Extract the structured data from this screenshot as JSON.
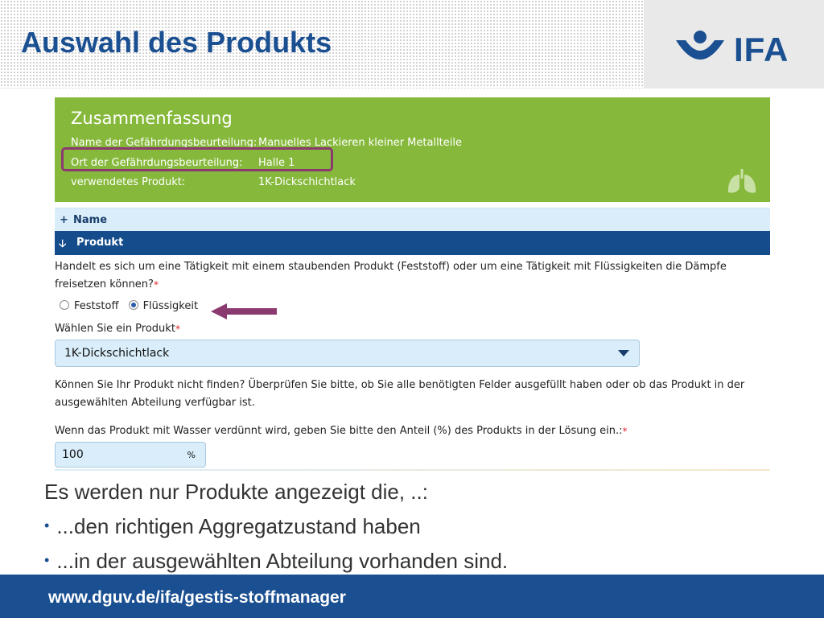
{
  "slide": {
    "title": "Auswahl des Produkts"
  },
  "logo": {
    "text": "IFA"
  },
  "summary": {
    "title": "Zusammenfassung",
    "rows": [
      {
        "label": "Name der Gefährdungsbeurteilung:",
        "value": "Manuelles Lackieren kleiner Metallteile"
      },
      {
        "label": "Ort der Gefährdungsbeurteilung:",
        "value": "Halle 1"
      },
      {
        "label": "verwendetes Produkt:",
        "value": "1K-Dickschichtlack"
      }
    ]
  },
  "sections": {
    "name": {
      "icon": "+",
      "label": "Name"
    },
    "produkt": {
      "icon": "🡣",
      "label": "Produkt"
    }
  },
  "form": {
    "question_line1": "Handelt es sich um eine Tätigkeit mit einem staubenden Produkt (Feststoff) oder um eine Tätigkeit mit Flüssigkeiten die Dämpfe",
    "question_line2": "freisetzen können?",
    "required_mark": "*",
    "radio_options": [
      "Feststoff",
      "Flüssigkeit"
    ],
    "radio_selected": "Flüssigkeit",
    "product_label": "Wählen Sie ein Produkt",
    "product_value": "1K-Dickschichtlack",
    "notfound_line1": "Können Sie Ihr Produkt nicht finden? Überprüfen Sie bitte, ob Sie alle benötigten Felder ausgefüllt haben oder ob das Produkt in der",
    "notfound_line2": "ausgewählten Abteilung verfügbar ist.",
    "dilution_label": "Wenn das Produkt mit Wasser verdünnt wird, geben Sie bitte den Anteil (%) des Produkts in der Lösung ein.:",
    "dilution_value": "100",
    "dilution_unit": "%"
  },
  "notes": {
    "intro": "Es werden nur Produkte angezeigt die, ..:",
    "bullet_char": "•",
    "items": [
      "...den richtigen Aggregatzustand haben",
      "...in der ausgewählten Abteilung vorhanden sind."
    ]
  },
  "footer": {
    "url": "www.dguv.de/ifa/gestis-stoffmanager"
  },
  "colors": {
    "brand_blue": "#1a4f91",
    "summary_green": "#86b93b",
    "highlight": "#8b3a6f",
    "field_bg": "#d9eefa"
  },
  "icons": {
    "logo_mark": "dguv-logo-icon",
    "lungs": "lungs-icon",
    "arrow": "arrow-left-icon"
  }
}
